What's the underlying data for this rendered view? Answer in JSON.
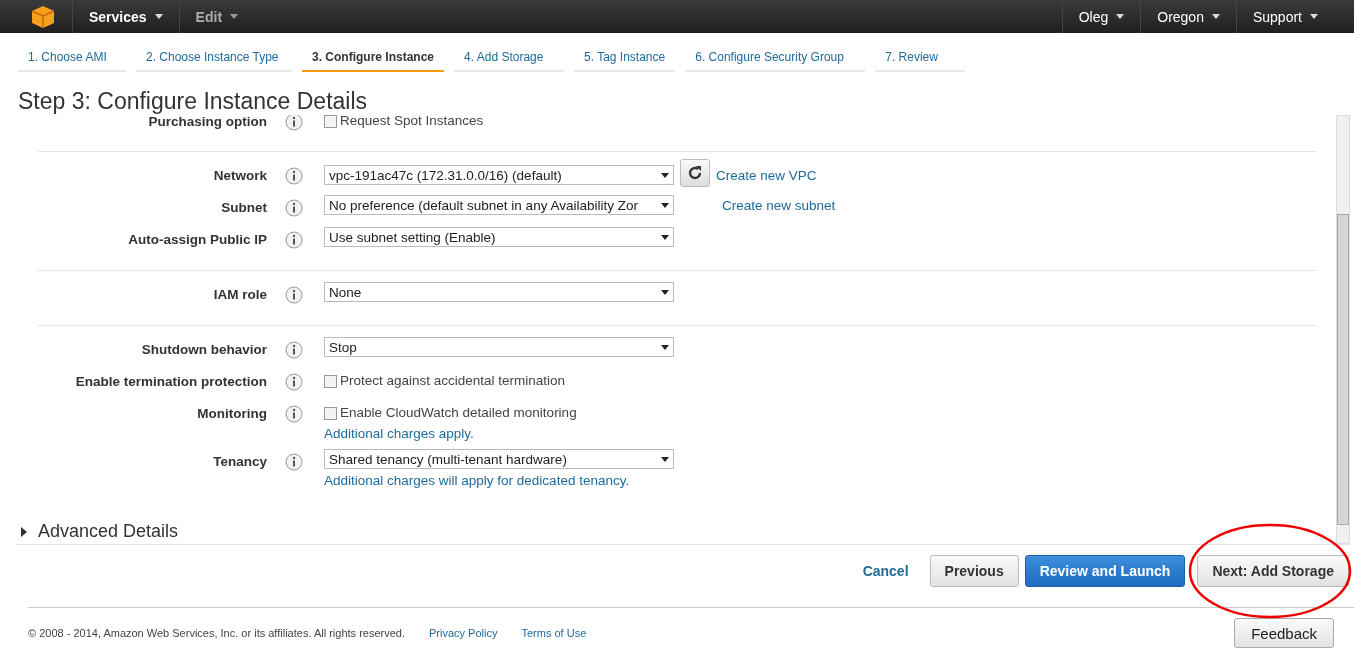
{
  "topbar": {
    "menus_left": [
      {
        "label": "Services",
        "disabled": false
      },
      {
        "label": "Edit",
        "disabled": true
      }
    ],
    "menus_right": [
      "Oleg",
      "Oregon",
      "Support"
    ]
  },
  "steps": [
    {
      "label": "1. Choose AMI",
      "selected": false
    },
    {
      "label": "2. Choose Instance Type",
      "selected": false
    },
    {
      "label": "3. Configure Instance",
      "selected": true
    },
    {
      "label": "4. Add Storage",
      "selected": false
    },
    {
      "label": "5. Tag Instance",
      "selected": false
    },
    {
      "label": "6. Configure Security Group",
      "selected": false
    },
    {
      "label": "7. Review",
      "selected": false
    }
  ],
  "title": "Step 3: Configure Instance Details",
  "groups": [
    {
      "rows": [
        {
          "label": "Purchasing option",
          "kind": "checkbox",
          "text": "Request Spot Instances",
          "checked": false
        }
      ]
    },
    {
      "rows": [
        {
          "label": "Network",
          "kind": "select",
          "value": "vpc-191ac47c (172.31.0.0/16) (default)",
          "refresh": true,
          "link": "Create new VPC"
        },
        {
          "label": "Subnet",
          "kind": "select",
          "value": "No preference (default subnet in any Availability Zor",
          "link": "Create new subnet"
        },
        {
          "label": "Auto-assign Public IP",
          "kind": "select",
          "value": "Use subnet setting (Enable)"
        }
      ]
    },
    {
      "rows": [
        {
          "label": "IAM role",
          "kind": "select",
          "value": "None"
        }
      ]
    },
    {
      "rows": [
        {
          "label": "Shutdown behavior",
          "kind": "select",
          "value": "Stop"
        },
        {
          "label": "Enable termination protection",
          "kind": "checkbox",
          "text": "Protect against accidental termination",
          "checked": false
        },
        {
          "label": "Monitoring",
          "kind": "checkbox",
          "text": "Enable CloudWatch detailed monitoring",
          "checked": false,
          "note": "Additional charges apply."
        },
        {
          "label": "Tenancy",
          "kind": "select",
          "value": "Shared tenancy (multi-tenant hardware)",
          "note": "Additional charges will apply for dedicated tenancy."
        }
      ]
    }
  ],
  "advanced": {
    "label": "Advanced Details",
    "expanded": false
  },
  "actions": {
    "cancel": "Cancel",
    "previous": "Previous",
    "primary": "Review and Launch",
    "next": "Next: Add Storage"
  },
  "footer": {
    "copyright": "© 2008 - 2014, Amazon Web Services, Inc. or its affiliates. All rights reserved.",
    "links": [
      "Privacy Policy",
      "Terms of Use"
    ],
    "feedback": "Feedback"
  }
}
